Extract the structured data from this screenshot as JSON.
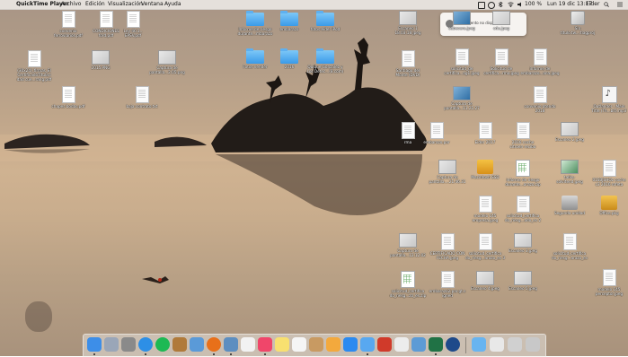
{
  "menubar": {
    "app_name": "QuickTime Player",
    "menus": [
      "Archivo",
      "Edición",
      "Visualización",
      "Ventana",
      "Ayuda"
    ],
    "battery": "100 %",
    "clock": "Lun 19 dic  13:17",
    "user": "Eider"
  },
  "notification": {
    "text": "Este evento no disponible"
  },
  "desktop_items": [
    {
      "label": "convenio\nferroviarios.pdf",
      "icon": "pdf-doc"
    },
    {
      "label": "CONDICIONES\nford.pdf",
      "icon": "pdf-doc"
    },
    {
      "label": "Ley 46.1..\nEPSV.pdf",
      "icon": "pdf-doc"
    },
    {
      "label": "Informe de riesgo\ndurante...mbarazo",
      "icon": "folder"
    },
    {
      "label": "embarazo",
      "icon": "folder"
    },
    {
      "label": "fotos eider iPod",
      "icon": "folder"
    },
    {
      "label": "Escaneo 1\n18.03.18.jpeg",
      "icon": "scan-image"
    },
    {
      "label": "cabecera.jpeg",
      "icon": "image"
    },
    {
      "label": "cdu.jpeg",
      "icon": "image"
    },
    {
      "label": "Sin\ntítulo.tw....tiagproj",
      "icon": "project-file"
    },
    {
      "label": "(30x24)_firmas_El\nCertificadoTitulari\ndad cue...rang.pdf",
      "icon": "pdf-doc"
    },
    {
      "label": "2015.PNG",
      "icon": "image"
    },
    {
      "label": "Captura de\npantalla...2.05.png",
      "icon": "image"
    },
    {
      "label": "Fotos vender",
      "icon": "folder"
    },
    {
      "label": "2016",
      "icon": "folder"
    },
    {
      "label": "Quique González y\nLos Detec...(8.com)",
      "icon": "folder"
    },
    {
      "label": "Santiago del\nMonte (DVD)",
      "icon": "document"
    },
    {
      "label": "solicitud_de\ncertifica...ag1.jpeg",
      "icon": "document"
    },
    {
      "label": "Solicitud de\ncertifica...rma.jpeg",
      "icon": "document"
    },
    {
      "label": "informe de\nembarazo...ana.jpeg",
      "icon": "document"
    },
    {
      "label": "chapes bodas.pdf",
      "icon": "pdf-doc"
    },
    {
      "label": "baja contrato.txt",
      "icon": "text-doc"
    },
    {
      "label": "Captura de\npantalla...11.21.27",
      "icon": "image"
    },
    {
      "label": "convenio atendo\n2018",
      "icon": "document"
    },
    {
      "label": "Outlander - Main\nTitle (Th...bit).mp3",
      "icon": "audio-file"
    },
    {
      "label": "rma",
      "icon": "document"
    },
    {
      "label": "embarazo.par",
      "icon": "document"
    },
    {
      "label": "Eider 2017",
      "icon": "document"
    },
    {
      "label": "2016 coche\ncitroen recibo",
      "icon": "document"
    },
    {
      "label": "Escaneo 2.jpeg",
      "icon": "scan-image"
    },
    {
      "label": "Captura de\npantalla....21.46.31",
      "icon": "image"
    },
    {
      "label": "Macintosh SSD",
      "icon": "hard-drive"
    },
    {
      "label": "informe de riesgo\ndurante...arazo.zip",
      "icon": "archive"
    },
    {
      "label": "tabla-\nsolvitend.jpeg",
      "icon": "image"
    },
    {
      "label": "01SBJSHOz coche\nc3 2016 rofeta",
      "icon": "document"
    },
    {
      "label": "modelo 145\nempresa.jpeg",
      "icon": "document"
    },
    {
      "label": "solicitud_certifica\ndo_riesg...ado_es 2",
      "icon": "document"
    },
    {
      "label": "Segunda unidad",
      "icon": "external-drive"
    },
    {
      "label": "Office.pkg",
      "icon": "package"
    },
    {
      "label": "Captura de\npantalla...12.12.02",
      "icon": "image"
    },
    {
      "label": "CERTIFICADO CON\nFECHA.jpeg",
      "icon": "document"
    },
    {
      "label": "solicitud_certifica\ndo_riesg...arazo_es 3",
      "icon": "document"
    },
    {
      "label": "Escaneo 3.jpeg",
      "icon": "scan-image"
    },
    {
      "label": "solicitud_certifica\ndo_riesg...arazo_es",
      "icon": "document"
    },
    {
      "label": "solicitud_certifica\ndo_riesg...zo_es.zip",
      "icon": "archive"
    },
    {
      "label": "embarazo2.par.gt.s\nigned",
      "icon": "document"
    },
    {
      "label": "Escaneo 4.jpeg",
      "icon": "scan-image"
    },
    {
      "label": "Escaneo 5.jpeg",
      "icon": "scan-image"
    },
    {
      "label": "modelo 145\nperceptor.jpeg",
      "icon": "document"
    }
  ],
  "dock": {
    "apps": [
      {
        "name": "finder-icon",
        "color": "#3d8ee8"
      },
      {
        "name": "launchpad-icon",
        "color": "#9aa6b8"
      },
      {
        "name": "system-preferences-icon",
        "color": "#8a8a8a"
      },
      {
        "name": "safari-icon",
        "color": "#2d8fe6"
      },
      {
        "name": "spotify-icon",
        "color": "#1db954"
      },
      {
        "name": "notes-icon",
        "color": "#b07a3a"
      },
      {
        "name": "mail-icon",
        "color": "#5a9ad8"
      },
      {
        "name": "firefox-icon",
        "color": "#e8701a"
      },
      {
        "name": "preview-icon",
        "color": "#5d8ec0"
      },
      {
        "name": "calendar-icon",
        "color": "#f2f2f2"
      },
      {
        "name": "music-icon",
        "color": "#f0466a"
      },
      {
        "name": "stickies-icon",
        "color": "#f8e070"
      },
      {
        "name": "reminders-icon",
        "color": "#f5f5f5"
      },
      {
        "name": "contacts-icon",
        "color": "#c89a62"
      },
      {
        "name": "photos-icon",
        "color": "#f3a93d"
      },
      {
        "name": "app-store-icon",
        "color": "#2b8af0"
      },
      {
        "name": "messages-icon",
        "color": "#58a8f0"
      },
      {
        "name": "photo-booth-icon",
        "color": "#d03a2a"
      },
      {
        "name": "preview-mail-icon",
        "color": "#ececec"
      },
      {
        "name": "image-capture-icon",
        "color": "#5d9bd5"
      },
      {
        "name": "excel-icon",
        "color": "#207245"
      },
      {
        "name": "quicktime-icon",
        "color": "#1e4a8a"
      }
    ],
    "stacks": [
      {
        "name": "applications-folder-icon",
        "color": "#68b4f0"
      },
      {
        "name": "documents-stack-icon",
        "color": "#e8e8e8"
      },
      {
        "name": "downloads-stack-icon",
        "color": "#d0d0d0"
      },
      {
        "name": "trash-icon",
        "color": "#c8c8c8"
      }
    ]
  },
  "colors": {
    "folder": "#3a9ae8",
    "menubar_bg": "#ebe8e4"
  }
}
